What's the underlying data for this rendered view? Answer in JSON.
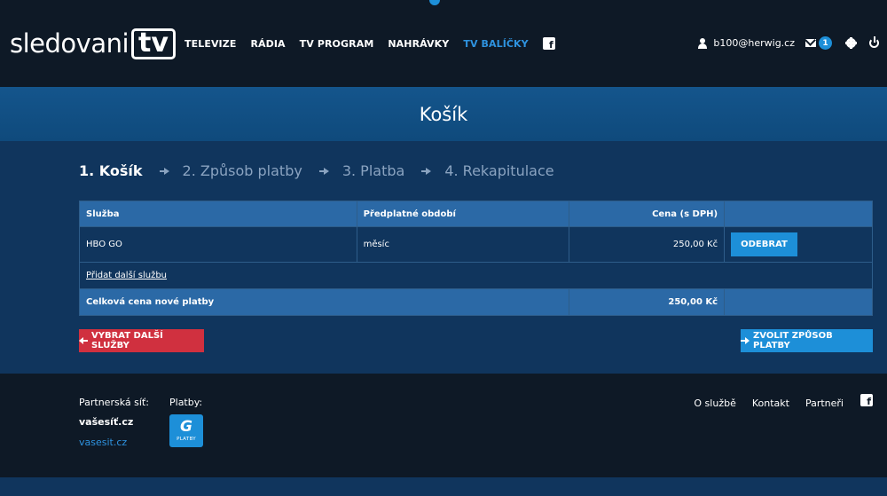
{
  "header": {
    "logo_text": "sledovani",
    "logo_box": "tv",
    "nav": [
      {
        "label": "TELEVIZE"
      },
      {
        "label": "RÁDIA"
      },
      {
        "label": "TV PROGRAM"
      },
      {
        "label": "NAHRÁVKY"
      },
      {
        "label": "TV BALÍČKY"
      }
    ],
    "fb_glyph": "f",
    "user_email": "b100@herwig.cz",
    "message_count": "1"
  },
  "page": {
    "title": "Košík"
  },
  "steps": [
    {
      "label": "1. Košík"
    },
    {
      "label": "2. Způsob platby"
    },
    {
      "label": "3. Platba"
    },
    {
      "label": "4. Rekapitulace"
    }
  ],
  "table": {
    "headers": {
      "service": "Služba",
      "period": "Předplatné období",
      "price": "Cena (s DPH)"
    },
    "rows": [
      {
        "service": "HBO GO",
        "period": "měsíc",
        "price": "250,00 Kč",
        "action": "ODEBRAT"
      }
    ],
    "add_link": "Přidat další službu",
    "total_label": "Celková cena nové platby",
    "total_value": "250,00 Kč"
  },
  "buttons": {
    "back": "VYBRAT DALŠÍ SLUŽBY",
    "next": "ZVOLIT ZPŮSOB PLATBY"
  },
  "footer": {
    "partner_label": "Partnerská síť:",
    "partner_name": "vašesíť.cz",
    "partner_link": "vasesit.cz",
    "payments_label": "Platby:",
    "gopay_mark": "G",
    "gopay_text": "PLATBY",
    "links": [
      {
        "label": "O službě"
      },
      {
        "label": "Kontakt"
      },
      {
        "label": "Partneři"
      }
    ],
    "fb_glyph": "f"
  },
  "colors": {
    "accent": "#1d8fd8",
    "danger": "#d0303f",
    "nav_active": "#2e93e0",
    "header_bg": "#0e1926",
    "main_bg": "#10355d"
  }
}
